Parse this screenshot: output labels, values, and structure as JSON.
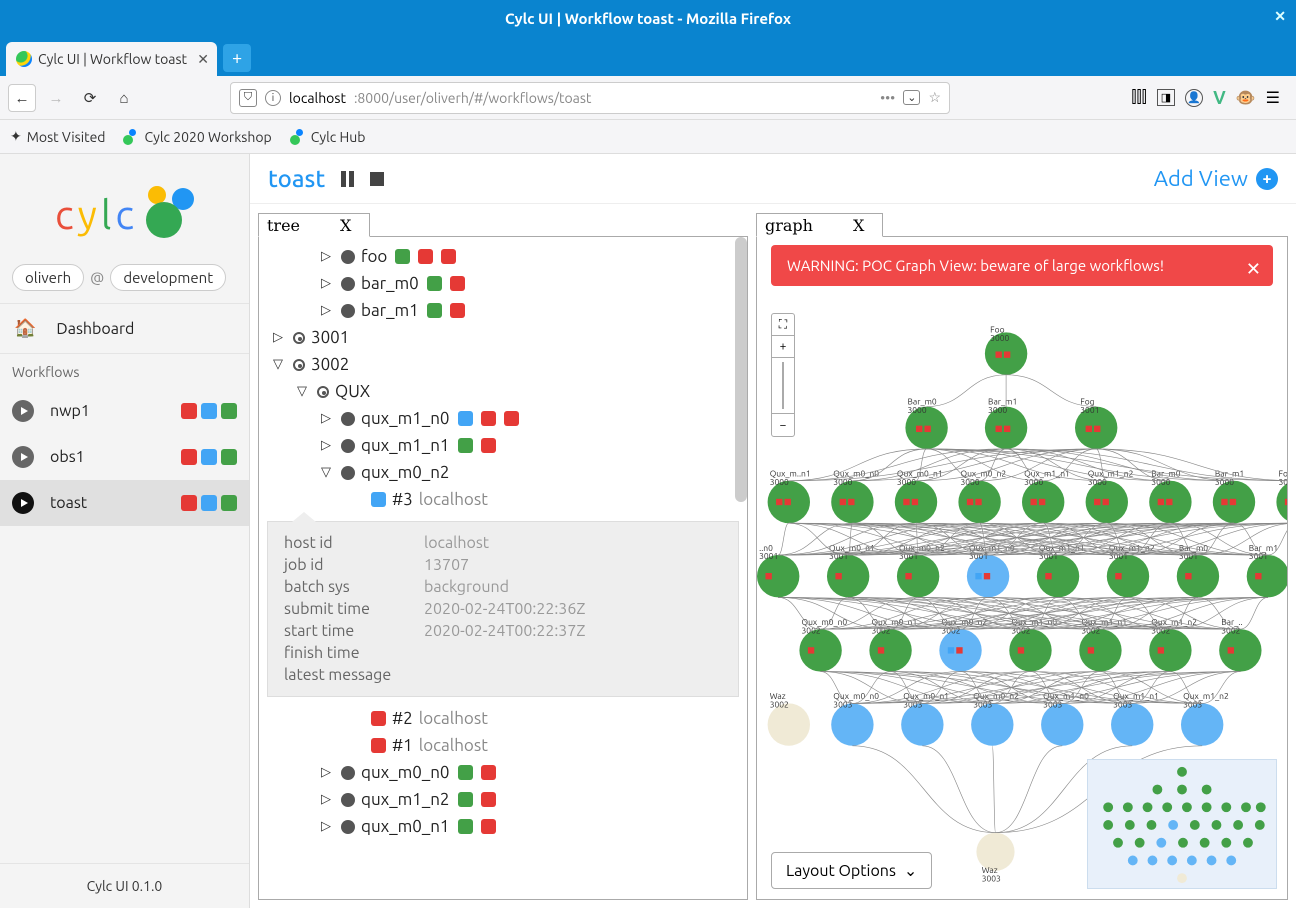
{
  "window": {
    "title": "Cylc UI | Workflow toast - Mozilla Firefox"
  },
  "browser": {
    "tab_title": "Cylc UI | Workflow toast",
    "url_host": "localhost",
    "url_port_path": ":8000/user/oliverh/#/workflows/toast",
    "bookmarks": [
      "Most Visited",
      "Cylc 2020 Workshop",
      "Cylc Hub"
    ]
  },
  "sidebar": {
    "user": "oliverh",
    "env": "development",
    "dashboard": "Dashboard",
    "section": "Workflows",
    "workflows": [
      {
        "name": "nwp1",
        "active": false
      },
      {
        "name": "obs1",
        "active": false
      },
      {
        "name": "toast",
        "active": true
      }
    ],
    "footer": "Cylc UI 0.1.0"
  },
  "header": {
    "workflow": "toast",
    "addview": "Add View"
  },
  "tree": {
    "tab": "tree",
    "rows": [
      {
        "ind": 2,
        "tri": "▷",
        "dot": "solid",
        "label": "foo",
        "sq": [
          "g",
          "r",
          "r"
        ]
      },
      {
        "ind": 2,
        "tri": "▷",
        "dot": "solid",
        "label": "bar_m0",
        "sq": [
          "g",
          "r"
        ]
      },
      {
        "ind": 2,
        "tri": "▷",
        "dot": "solid",
        "label": "bar_m1",
        "sq": [
          "g",
          "r"
        ]
      },
      {
        "ind": 0,
        "tri": "▷",
        "dot": "ring",
        "label": "3001",
        "sq": []
      },
      {
        "ind": 0,
        "tri": "▽",
        "dot": "ring",
        "label": "3002",
        "sq": []
      },
      {
        "ind": 1,
        "tri": "▽",
        "dot": "ring",
        "label": "QUX",
        "sq": []
      },
      {
        "ind": 2,
        "tri": "▷",
        "dot": "solid",
        "label": "qux_m1_n0",
        "sq": [
          "b",
          "r",
          "r"
        ]
      },
      {
        "ind": 2,
        "tri": "▷",
        "dot": "solid",
        "label": "qux_m1_n1",
        "sq": [
          "g",
          "r"
        ]
      },
      {
        "ind": 2,
        "tri": "▽",
        "dot": "solid",
        "label": "qux_m0_n2",
        "sq": []
      },
      {
        "ind": 4,
        "tri": "",
        "dot": "",
        "label": "#3 localhost",
        "sq_pre": [
          "b"
        ]
      }
    ],
    "rows_after": [
      {
        "ind": 4,
        "tri": "",
        "dot": "",
        "label": "#2 localhost",
        "sq_pre": [
          "r"
        ]
      },
      {
        "ind": 4,
        "tri": "",
        "dot": "",
        "label": "#1 localhost",
        "sq_pre": [
          "r"
        ]
      },
      {
        "ind": 2,
        "tri": "▷",
        "dot": "solid",
        "label": "qux_m0_n0",
        "sq": [
          "g",
          "r"
        ]
      },
      {
        "ind": 2,
        "tri": "▷",
        "dot": "solid",
        "label": "qux_m1_n2",
        "sq": [
          "g",
          "r"
        ]
      },
      {
        "ind": 2,
        "tri": "▷",
        "dot": "solid",
        "label": "qux_m0_n1",
        "sq": [
          "g",
          "r"
        ]
      }
    ],
    "detail": {
      "host_id_k": "host id",
      "host_id_v": "localhost",
      "job_id_k": "job id",
      "job_id_v": "13707",
      "batch_k": "batch sys",
      "batch_v": "background",
      "submit_k": "submit time",
      "submit_v": "2020-02-24T00:22:36Z",
      "start_k": "start time",
      "start_v": "2020-02-24T00:22:37Z",
      "finish_k": "finish time",
      "finish_v": "",
      "latest_k": "latest message",
      "latest_v": ""
    }
  },
  "graph": {
    "tab": "graph",
    "warning": "WARNING: POC Graph View: beware of large workflows!",
    "layout": "Layout Options",
    "node_labels": [
      "Foo",
      "Bar_m0",
      "Bar_m1",
      "Fog",
      "Qux_m0_n0",
      "Qux_m0_n1",
      "Qux_m0_n2",
      "Qux_m1_n0",
      "Qux_m1_n1",
      "Qux_m1_n2",
      "Bar_m0",
      "Bar_m1",
      "Waz"
    ],
    "cycle_labels": [
      "3000",
      "3001",
      "3002",
      "3003"
    ]
  }
}
